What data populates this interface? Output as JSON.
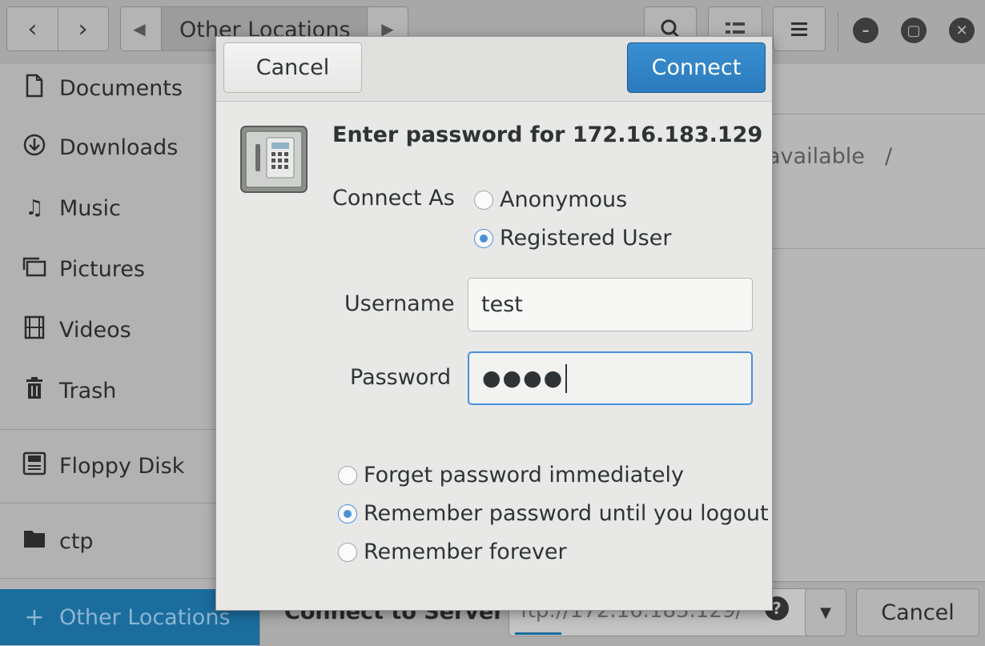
{
  "headerbar": {
    "path_label": "Other Locations"
  },
  "sidebar": {
    "items": [
      {
        "label": "Documents",
        "icon": "document-icon"
      },
      {
        "label": "Downloads",
        "icon": "download-icon"
      },
      {
        "label": "Music",
        "icon": "music-icon"
      },
      {
        "label": "Pictures",
        "icon": "pictures-icon"
      },
      {
        "label": "Videos",
        "icon": "video-icon"
      },
      {
        "label": "Trash",
        "icon": "trash-icon"
      },
      {
        "label": "Floppy Disk",
        "icon": "floppy-icon"
      },
      {
        "label": "ctp",
        "icon": "folder-icon"
      },
      {
        "label": "Other Locations",
        "icon": "plus-icon"
      }
    ]
  },
  "main": {
    "available_fragment": "available",
    "slash": "/"
  },
  "bottom_bar": {
    "connect_label": "Connect to Server",
    "address_value": "ftp://172.16.183.129/",
    "cancel_label": "Cancel"
  },
  "dialog": {
    "cancel_label": "Cancel",
    "connect_label": "Connect",
    "title": "Enter password for 172.16.183.129",
    "connect_as_label": "Connect As",
    "connect_as_options": [
      {
        "label": "Anonymous",
        "selected": false
      },
      {
        "label": "Registered User",
        "selected": true
      }
    ],
    "username_label": "Username",
    "username_value": "test",
    "password_label": "Password",
    "password_value": "●●●●",
    "remember_options": [
      {
        "label": "Forget password immediately",
        "selected": false
      },
      {
        "label": "Remember password until you logout",
        "selected": true
      },
      {
        "label": "Remember forever",
        "selected": false
      }
    ]
  },
  "colors": {
    "accent": "#2a7bbd",
    "radio_selected": "#4a90d9",
    "sidebar_active": "#1b6d9e"
  }
}
